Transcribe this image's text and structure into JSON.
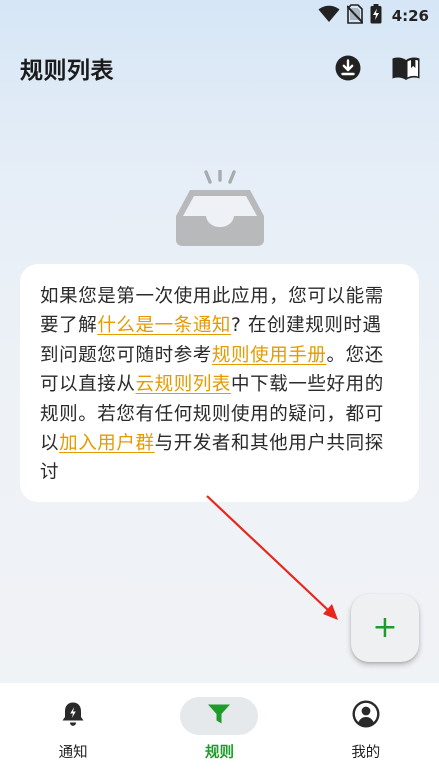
{
  "status_bar": {
    "time": "4:26",
    "icons": [
      "wifi-icon",
      "no-sim-icon",
      "battery-charging-icon"
    ]
  },
  "app_bar": {
    "title": "规则列表",
    "actions": [
      {
        "name": "download-icon"
      },
      {
        "name": "manual-book-icon"
      }
    ]
  },
  "empty_state": {
    "icon": "empty-inbox-icon"
  },
  "info_card": {
    "t1": "如果您是第一次使用此应用，您可以能需要了解",
    "link1": "什么是一条通知",
    "t2": "? 在创建规则时遇到问题您可随时参考",
    "link2": "规则使用手册",
    "t3": "。您还可以直接从",
    "link3": "云规则列表",
    "t4": "中下载一些好用的规则。若您有任何规则使用的疑问，都可以",
    "link4": "加入用户群",
    "t5": "与开发者和其他用户共同探讨"
  },
  "fab": {
    "label": "+",
    "icon": "add-icon"
  },
  "bottom_nav": {
    "items": [
      {
        "label": "通知",
        "icon": "bell-icon",
        "active": false
      },
      {
        "label": "规则",
        "icon": "filter-icon",
        "active": true
      },
      {
        "label": "我的",
        "icon": "account-icon",
        "active": false
      }
    ]
  },
  "colors": {
    "accent": "#1e9b2a",
    "link": "#e59a00",
    "annotation_arrow": "#e8261c"
  }
}
